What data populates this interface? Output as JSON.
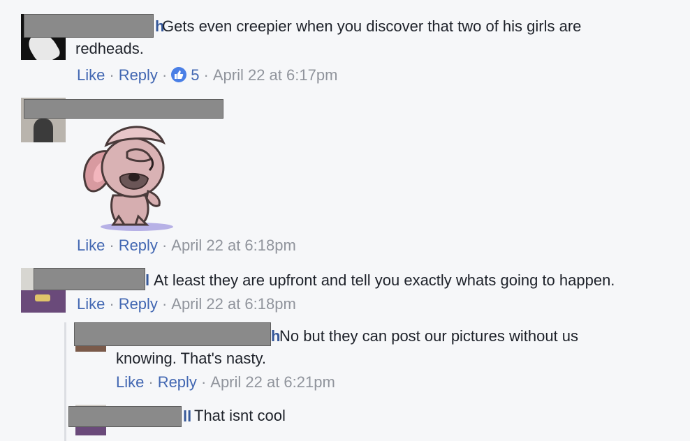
{
  "comments": [
    {
      "text": "Gets even creepier when you discover that two of his girls are redheads.",
      "like_label": "Like",
      "reply_label": "Reply",
      "reaction_count": "5",
      "timestamp": "April 22 at 6:17pm"
    },
    {
      "sticker": "facepalm-puppy-sticker",
      "like_label": "Like",
      "reply_label": "Reply",
      "timestamp": "April 22 at 6:18pm"
    },
    {
      "text": "At least they are upfront and tell you exactly whats going to happen.",
      "like_label": "Like",
      "reply_label": "Reply",
      "timestamp": "April 22 at 6:18pm"
    }
  ],
  "replies": [
    {
      "text": "No but they can post our pictures without us knowing. That's nasty.",
      "like_label": "Like",
      "reply_label": "Reply",
      "timestamp": "April 22 at 6:21pm"
    },
    {
      "text": "That isnt cool"
    }
  ],
  "colors": {
    "link": "#4267b2",
    "meta": "#90949c",
    "background": "#f6f7f9",
    "like_badge": "#4a7fe6"
  }
}
